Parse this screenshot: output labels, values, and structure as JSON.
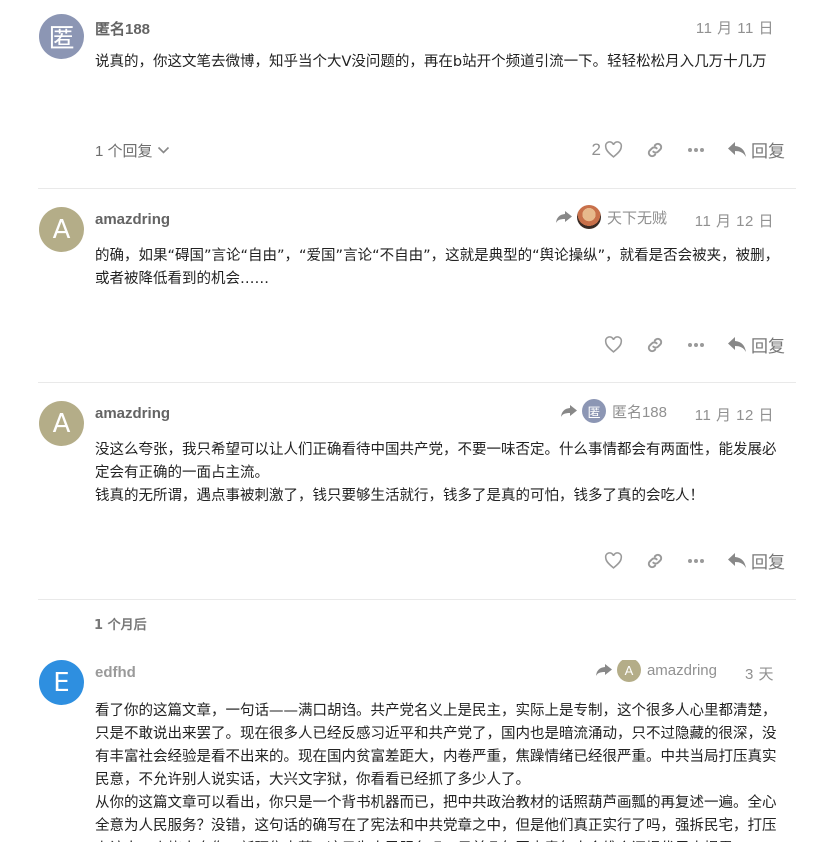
{
  "posts": [
    {
      "username": "匿名188",
      "avatar_letter": "匿",
      "avatar_color": "#8c96b4",
      "date": "11 月 11 日",
      "reply_to": null,
      "paragraphs": [
        "说真的，你这文笔去微博，知乎当个大V没问题的，再在b站开个频道引流一下。轻轻松松月入几万十几万"
      ],
      "replies_label": "1 个回复",
      "like_count": "2",
      "reply_label": "回复"
    },
    {
      "username": "amazdring",
      "avatar_letter": "A",
      "avatar_color": "#b4ad88",
      "date": "11 月 12 日",
      "reply_to": {
        "name": "天下无贼",
        "avatar_letter": "",
        "avatar_color": "#c8704a"
      },
      "paragraphs": [
        "的确，如果“碍国”言论“自由”，“爱国”言论“不自由”，这就是典型的“舆论操纵”，就看是否会被夹，被删，或者被降低看到的机会……"
      ],
      "like_count": "",
      "reply_label": "回复"
    },
    {
      "username": "amazdring",
      "avatar_letter": "A",
      "avatar_color": "#b4ad88",
      "date": "11 月 12 日",
      "reply_to": {
        "name": "匿名188",
        "avatar_letter": "匿",
        "avatar_color": "#8c96b4"
      },
      "paragraphs": [
        "没这么夸张，我只希望可以让人们正确看待中国共产党，不要一味否定。什么事情都会有两面性，能发展必定会有正确的一面占主流。",
        "钱真的无所谓，遇点事被刺激了，钱只要够生活就行，钱多了是真的可怕，钱多了真的会吃人！"
      ],
      "like_count": "",
      "reply_label": "回复"
    },
    {
      "username": "edfhd",
      "avatar_letter": "E",
      "avatar_color": "#2e8fe0",
      "date": "3 天",
      "reply_to": {
        "name": "amazdring",
        "avatar_letter": "A",
        "avatar_color": "#b4ad88"
      },
      "paragraphs": [
        "看了你的这篇文章，一句话——满口胡诌。共产党名义上是民主，实际上是专制，这个很多人心里都清楚，只是不敢说出来罢了。现在很多人已经反感习近平和共产党了，国内也是暗流涌动，只不过隐藏的很深，没有丰富社会经验是看不出来的。现在国内贫富差距大，内卷严重，焦躁情绪已经很严重。中共当局打压真实民意，不允许别人说实话，大兴文字狱，你看看已经抓了多少人了。",
        "从你的这篇文章可以看出，你只是一个背书机器而已，把中共政治教材的话照葫芦画瓢的再复述一遍。全心全意为人民服务？没错，这句话的确写在了宪法和中共党章之中，但是他们真正实行了吗，强拆民宅，打压上访人，火烧人身伤，新疆集中营，这只为人民服务吗，目前几年国内青年人会维众还提优里来揭露"
      ]
    }
  ],
  "time_gap_label": "1 个月后"
}
